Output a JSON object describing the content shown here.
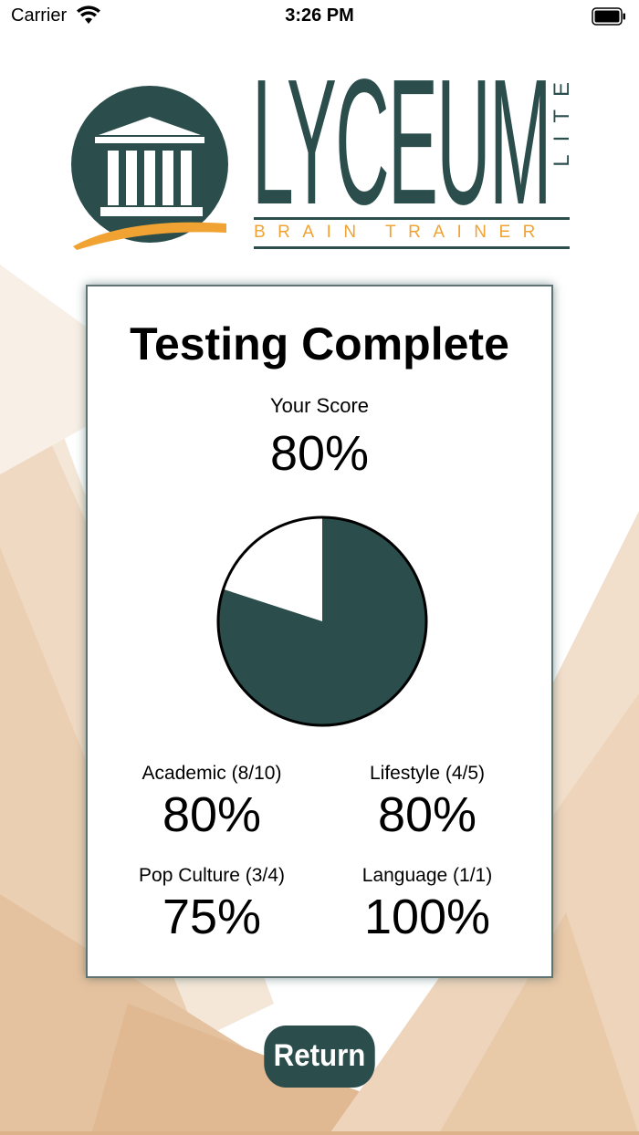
{
  "status_bar": {
    "carrier": "Carrier",
    "time": "3:26 PM"
  },
  "logo": {
    "title": "LYCEUM",
    "edition": "LITE",
    "subtitle": "BRAIN TRAINER"
  },
  "colors": {
    "brand": "#2b4d4c",
    "accent": "#f0a332"
  },
  "result": {
    "title": "Testing Complete",
    "score_label": "Your Score",
    "score_value": "80%",
    "score_fraction": 0.8
  },
  "categories": [
    {
      "label": "Academic (8/10)",
      "value": "80%"
    },
    {
      "label": "Lifestyle (4/5)",
      "value": "80%"
    },
    {
      "label": "Pop Culture (3/4)",
      "value": "75%"
    },
    {
      "label": "Language (1/1)",
      "value": "100%"
    }
  ],
  "actions": {
    "return_label": "Return"
  }
}
